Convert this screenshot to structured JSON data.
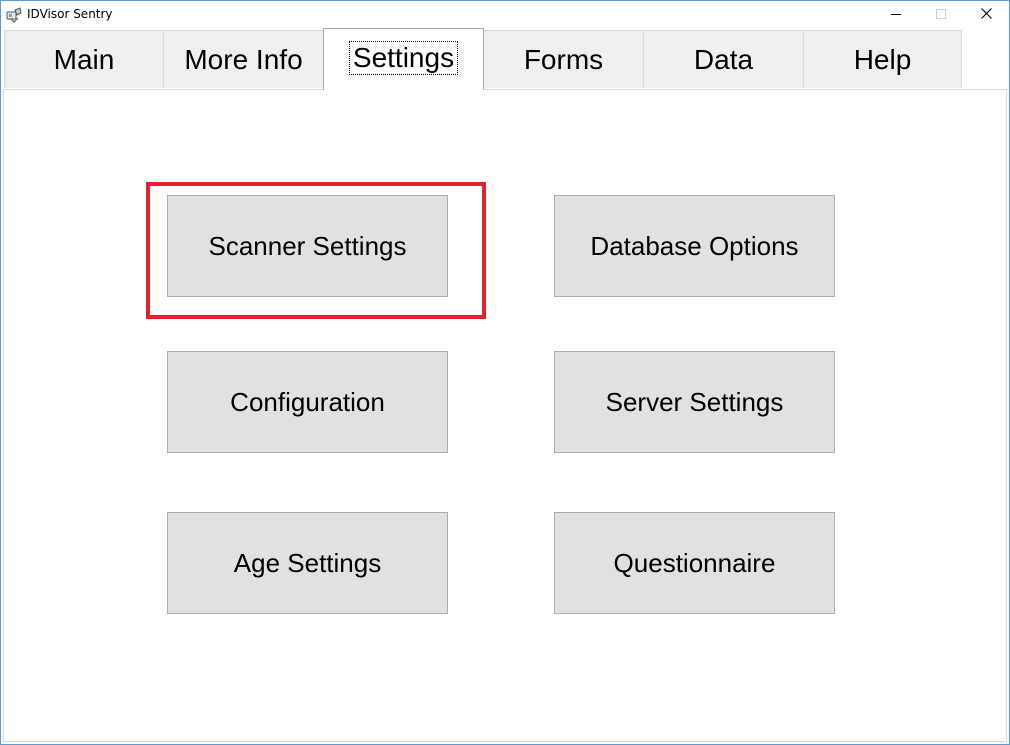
{
  "window": {
    "title": "IDVisor Sentry",
    "icon": "id-scanner-app-icon",
    "controls": {
      "minimize_icon": "minimize-icon",
      "maximize_icon": "maximize-icon",
      "close_icon": "close-icon"
    }
  },
  "tabs": [
    {
      "label": "Main",
      "active": false
    },
    {
      "label": "More Info",
      "active": false
    },
    {
      "label": "Settings",
      "active": true
    },
    {
      "label": "Forms",
      "active": false
    },
    {
      "label": "Data",
      "active": false
    },
    {
      "label": "Help",
      "active": false
    }
  ],
  "settings": {
    "buttons": {
      "scanner_settings": "Scanner Settings",
      "database_options": "Database Options",
      "configuration": "Configuration",
      "server_settings": "Server Settings",
      "age_settings": "Age Settings",
      "questionnaire": "Questionnaire"
    },
    "highlighted": "scanner_settings"
  },
  "colors": {
    "highlight": "#e3212d",
    "button_face": "#e1e1e1",
    "tab_inactive": "#efefef",
    "window_border": "#5a9bd6"
  }
}
